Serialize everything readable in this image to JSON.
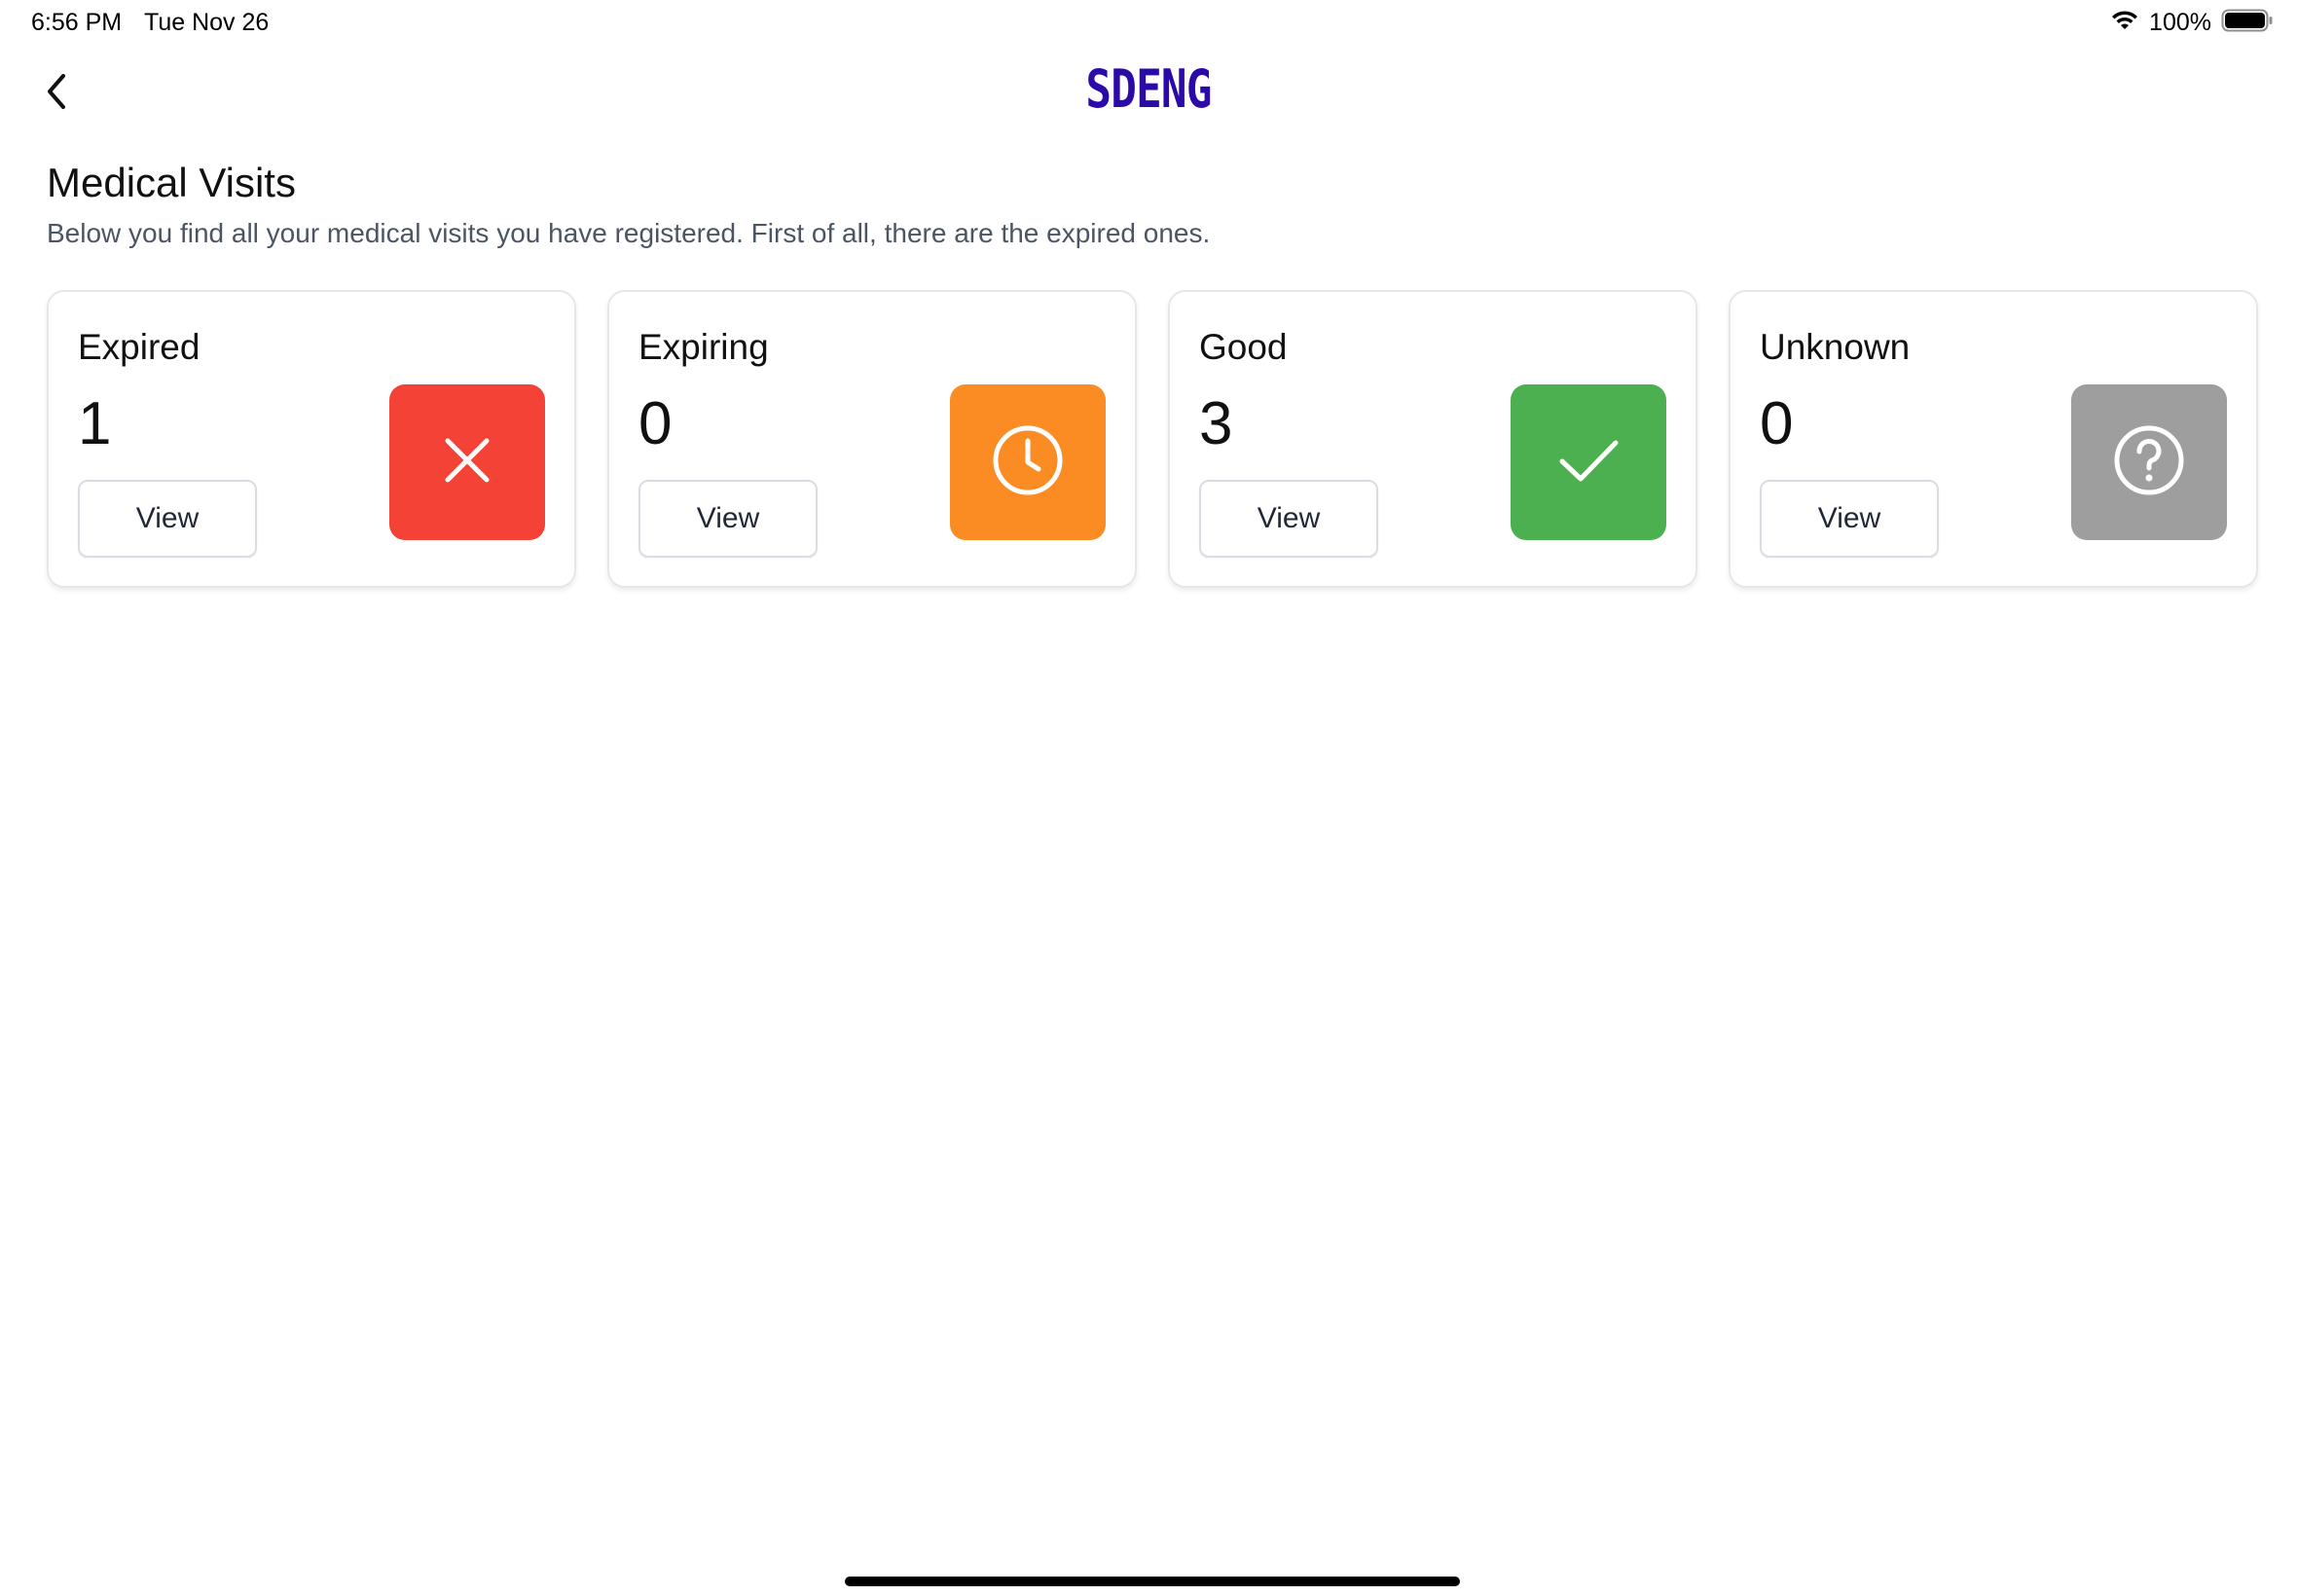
{
  "status_bar": {
    "time": "6:56 PM",
    "date": "Tue Nov 26",
    "battery": "100%"
  },
  "header": {
    "brand": "SDENG",
    "brand_color": "#2c0aa8",
    "back_icon": "chevron-left-icon"
  },
  "page": {
    "title": "Medical Visits",
    "subtitle": "Below you find all your medical visits you have registered. First of all, there are the expired ones."
  },
  "cards": [
    {
      "label": "Expired",
      "count": "1",
      "button": "View",
      "color": "#f44336",
      "icon": "close-icon"
    },
    {
      "label": "Expiring",
      "count": "0",
      "button": "View",
      "color": "#fb8c24",
      "icon": "clock-icon"
    },
    {
      "label": "Good",
      "count": "3",
      "button": "View",
      "color": "#4caf50",
      "icon": "check-icon"
    },
    {
      "label": "Unknown",
      "count": "0",
      "button": "View",
      "color": "#9e9e9e",
      "icon": "question-icon"
    }
  ]
}
